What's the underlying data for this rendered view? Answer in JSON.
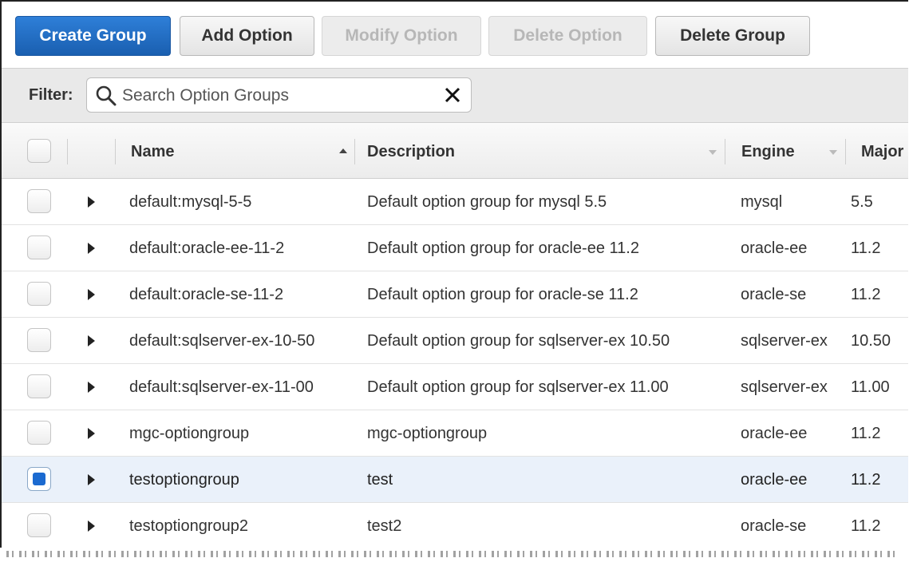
{
  "toolbar": {
    "create_group": "Create Group",
    "add_option": "Add Option",
    "modify_option": "Modify Option",
    "delete_option": "Delete Option",
    "delete_group": "Delete Group"
  },
  "filter": {
    "label": "Filter:",
    "placeholder": "Search Option Groups",
    "value": ""
  },
  "columns": {
    "name": "Name",
    "description": "Description",
    "engine": "Engine",
    "major": "Major"
  },
  "rows": [
    {
      "name": "default:mysql-5-5",
      "description": "Default option group for mysql 5.5",
      "engine": "mysql",
      "major": "5.5",
      "selected": false
    },
    {
      "name": "default:oracle-ee-11-2",
      "description": "Default option group for oracle-ee 11.2",
      "engine": "oracle-ee",
      "major": "11.2",
      "selected": false
    },
    {
      "name": "default:oracle-se-11-2",
      "description": "Default option group for oracle-se 11.2",
      "engine": "oracle-se",
      "major": "11.2",
      "selected": false
    },
    {
      "name": "default:sqlserver-ex-10-50",
      "description": "Default option group for sqlserver-ex 10.50",
      "engine": "sqlserver-ex",
      "major": "10.50",
      "selected": false
    },
    {
      "name": "default:sqlserver-ex-11-00",
      "description": "Default option group for sqlserver-ex 11.00",
      "engine": "sqlserver-ex",
      "major": "11.00",
      "selected": false
    },
    {
      "name": "mgc-optiongroup",
      "description": "mgc-optiongroup",
      "engine": "oracle-ee",
      "major": "11.2",
      "selected": false
    },
    {
      "name": "testoptiongroup",
      "description": "test",
      "engine": "oracle-ee",
      "major": "11.2",
      "selected": true
    },
    {
      "name": "testoptiongroup2",
      "description": "test2",
      "engine": "oracle-se",
      "major": "11.2",
      "selected": false
    }
  ],
  "icons": {
    "search": "search-icon",
    "clear": "close-icon",
    "expand": "triangle-right-icon",
    "sort_asc": "sort-ascending-icon",
    "sort_desc": "sort-descending-icon"
  },
  "colors": {
    "primary_button": "#1a5fb0",
    "selected_row": "#eaf1fa",
    "checkbox_checked": "#1b6ad0"
  }
}
